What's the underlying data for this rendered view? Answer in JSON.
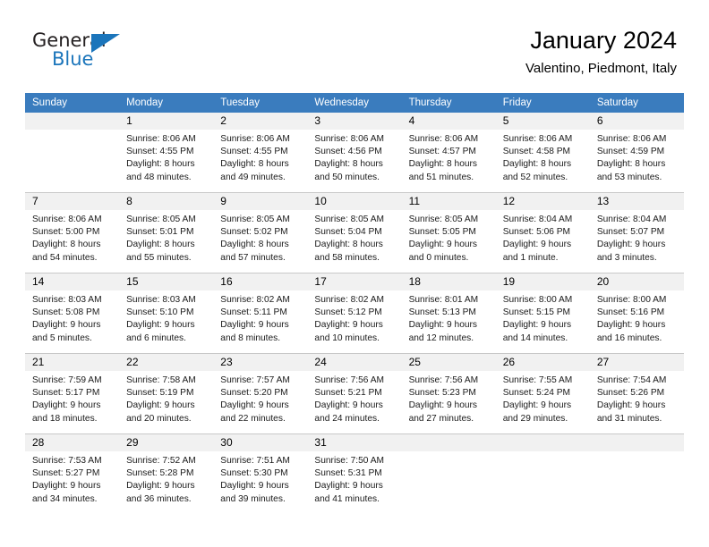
{
  "brand": {
    "name_part1": "General",
    "name_part2": "Blue"
  },
  "header": {
    "title": "January 2024",
    "subtitle": "Valentino, Piedmont, Italy"
  },
  "calendar": {
    "weekday_headers": [
      "Sunday",
      "Monday",
      "Tuesday",
      "Wednesday",
      "Thursday",
      "Friday",
      "Saturday"
    ],
    "accent_color": "#3a7cbe",
    "daynum_band_color": "#f1f1f1",
    "weeks": [
      [
        {
          "day": ""
        },
        {
          "day": "1",
          "sunrise": "Sunrise: 8:06 AM",
          "sunset": "Sunset: 4:55 PM",
          "daylight_line1": "Daylight: 8 hours",
          "daylight_line2": "and 48 minutes."
        },
        {
          "day": "2",
          "sunrise": "Sunrise: 8:06 AM",
          "sunset": "Sunset: 4:55 PM",
          "daylight_line1": "Daylight: 8 hours",
          "daylight_line2": "and 49 minutes."
        },
        {
          "day": "3",
          "sunrise": "Sunrise: 8:06 AM",
          "sunset": "Sunset: 4:56 PM",
          "daylight_line1": "Daylight: 8 hours",
          "daylight_line2": "and 50 minutes."
        },
        {
          "day": "4",
          "sunrise": "Sunrise: 8:06 AM",
          "sunset": "Sunset: 4:57 PM",
          "daylight_line1": "Daylight: 8 hours",
          "daylight_line2": "and 51 minutes."
        },
        {
          "day": "5",
          "sunrise": "Sunrise: 8:06 AM",
          "sunset": "Sunset: 4:58 PM",
          "daylight_line1": "Daylight: 8 hours",
          "daylight_line2": "and 52 minutes."
        },
        {
          "day": "6",
          "sunrise": "Sunrise: 8:06 AM",
          "sunset": "Sunset: 4:59 PM",
          "daylight_line1": "Daylight: 8 hours",
          "daylight_line2": "and 53 minutes."
        }
      ],
      [
        {
          "day": "7",
          "sunrise": "Sunrise: 8:06 AM",
          "sunset": "Sunset: 5:00 PM",
          "daylight_line1": "Daylight: 8 hours",
          "daylight_line2": "and 54 minutes."
        },
        {
          "day": "8",
          "sunrise": "Sunrise: 8:05 AM",
          "sunset": "Sunset: 5:01 PM",
          "daylight_line1": "Daylight: 8 hours",
          "daylight_line2": "and 55 minutes."
        },
        {
          "day": "9",
          "sunrise": "Sunrise: 8:05 AM",
          "sunset": "Sunset: 5:02 PM",
          "daylight_line1": "Daylight: 8 hours",
          "daylight_line2": "and 57 minutes."
        },
        {
          "day": "10",
          "sunrise": "Sunrise: 8:05 AM",
          "sunset": "Sunset: 5:04 PM",
          "daylight_line1": "Daylight: 8 hours",
          "daylight_line2": "and 58 minutes."
        },
        {
          "day": "11",
          "sunrise": "Sunrise: 8:05 AM",
          "sunset": "Sunset: 5:05 PM",
          "daylight_line1": "Daylight: 9 hours",
          "daylight_line2": "and 0 minutes."
        },
        {
          "day": "12",
          "sunrise": "Sunrise: 8:04 AM",
          "sunset": "Sunset: 5:06 PM",
          "daylight_line1": "Daylight: 9 hours",
          "daylight_line2": "and 1 minute."
        },
        {
          "day": "13",
          "sunrise": "Sunrise: 8:04 AM",
          "sunset": "Sunset: 5:07 PM",
          "daylight_line1": "Daylight: 9 hours",
          "daylight_line2": "and 3 minutes."
        }
      ],
      [
        {
          "day": "14",
          "sunrise": "Sunrise: 8:03 AM",
          "sunset": "Sunset: 5:08 PM",
          "daylight_line1": "Daylight: 9 hours",
          "daylight_line2": "and 5 minutes."
        },
        {
          "day": "15",
          "sunrise": "Sunrise: 8:03 AM",
          "sunset": "Sunset: 5:10 PM",
          "daylight_line1": "Daylight: 9 hours",
          "daylight_line2": "and 6 minutes."
        },
        {
          "day": "16",
          "sunrise": "Sunrise: 8:02 AM",
          "sunset": "Sunset: 5:11 PM",
          "daylight_line1": "Daylight: 9 hours",
          "daylight_line2": "and 8 minutes."
        },
        {
          "day": "17",
          "sunrise": "Sunrise: 8:02 AM",
          "sunset": "Sunset: 5:12 PM",
          "daylight_line1": "Daylight: 9 hours",
          "daylight_line2": "and 10 minutes."
        },
        {
          "day": "18",
          "sunrise": "Sunrise: 8:01 AM",
          "sunset": "Sunset: 5:13 PM",
          "daylight_line1": "Daylight: 9 hours",
          "daylight_line2": "and 12 minutes."
        },
        {
          "day": "19",
          "sunrise": "Sunrise: 8:00 AM",
          "sunset": "Sunset: 5:15 PM",
          "daylight_line1": "Daylight: 9 hours",
          "daylight_line2": "and 14 minutes."
        },
        {
          "day": "20",
          "sunrise": "Sunrise: 8:00 AM",
          "sunset": "Sunset: 5:16 PM",
          "daylight_line1": "Daylight: 9 hours",
          "daylight_line2": "and 16 minutes."
        }
      ],
      [
        {
          "day": "21",
          "sunrise": "Sunrise: 7:59 AM",
          "sunset": "Sunset: 5:17 PM",
          "daylight_line1": "Daylight: 9 hours",
          "daylight_line2": "and 18 minutes."
        },
        {
          "day": "22",
          "sunrise": "Sunrise: 7:58 AM",
          "sunset": "Sunset: 5:19 PM",
          "daylight_line1": "Daylight: 9 hours",
          "daylight_line2": "and 20 minutes."
        },
        {
          "day": "23",
          "sunrise": "Sunrise: 7:57 AM",
          "sunset": "Sunset: 5:20 PM",
          "daylight_line1": "Daylight: 9 hours",
          "daylight_line2": "and 22 minutes."
        },
        {
          "day": "24",
          "sunrise": "Sunrise: 7:56 AM",
          "sunset": "Sunset: 5:21 PM",
          "daylight_line1": "Daylight: 9 hours",
          "daylight_line2": "and 24 minutes."
        },
        {
          "day": "25",
          "sunrise": "Sunrise: 7:56 AM",
          "sunset": "Sunset: 5:23 PM",
          "daylight_line1": "Daylight: 9 hours",
          "daylight_line2": "and 27 minutes."
        },
        {
          "day": "26",
          "sunrise": "Sunrise: 7:55 AM",
          "sunset": "Sunset: 5:24 PM",
          "daylight_line1": "Daylight: 9 hours",
          "daylight_line2": "and 29 minutes."
        },
        {
          "day": "27",
          "sunrise": "Sunrise: 7:54 AM",
          "sunset": "Sunset: 5:26 PM",
          "daylight_line1": "Daylight: 9 hours",
          "daylight_line2": "and 31 minutes."
        }
      ],
      [
        {
          "day": "28",
          "sunrise": "Sunrise: 7:53 AM",
          "sunset": "Sunset: 5:27 PM",
          "daylight_line1": "Daylight: 9 hours",
          "daylight_line2": "and 34 minutes."
        },
        {
          "day": "29",
          "sunrise": "Sunrise: 7:52 AM",
          "sunset": "Sunset: 5:28 PM",
          "daylight_line1": "Daylight: 9 hours",
          "daylight_line2": "and 36 minutes."
        },
        {
          "day": "30",
          "sunrise": "Sunrise: 7:51 AM",
          "sunset": "Sunset: 5:30 PM",
          "daylight_line1": "Daylight: 9 hours",
          "daylight_line2": "and 39 minutes."
        },
        {
          "day": "31",
          "sunrise": "Sunrise: 7:50 AM",
          "sunset": "Sunset: 5:31 PM",
          "daylight_line1": "Daylight: 9 hours",
          "daylight_line2": "and 41 minutes."
        },
        {
          "day": ""
        },
        {
          "day": ""
        },
        {
          "day": ""
        }
      ]
    ]
  }
}
